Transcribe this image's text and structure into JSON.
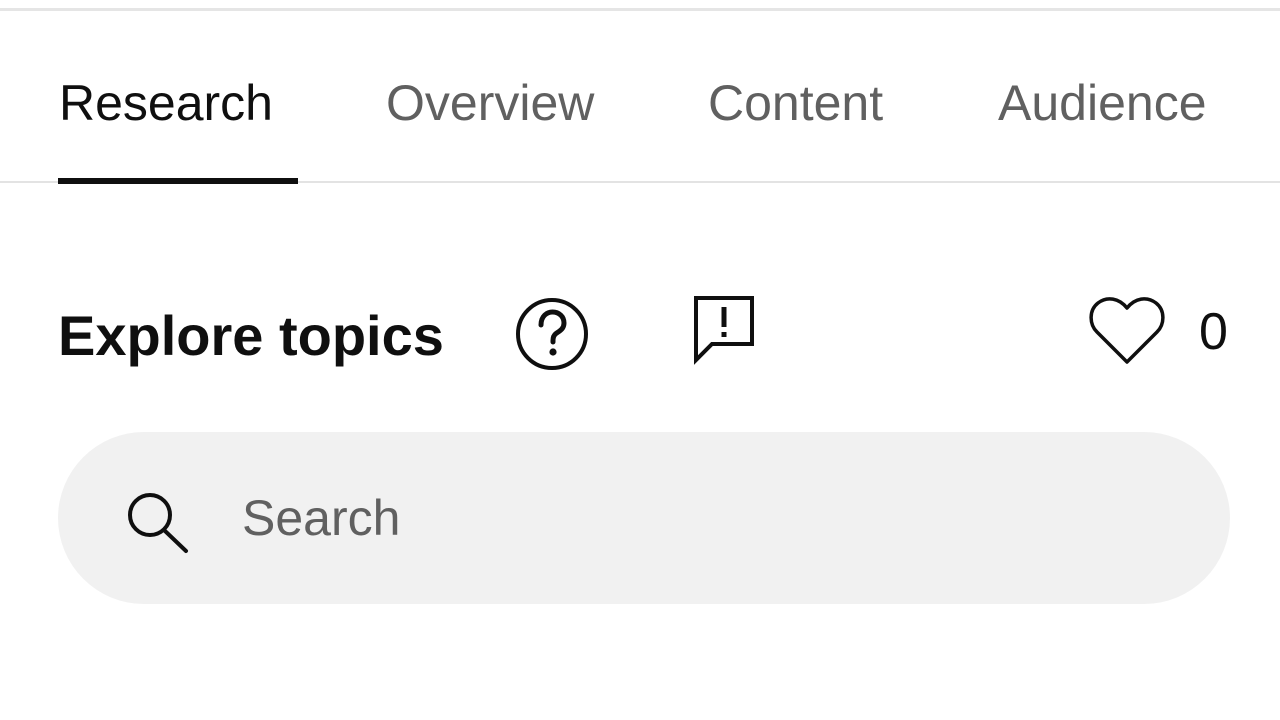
{
  "tabs": [
    {
      "label": "Research",
      "active": true
    },
    {
      "label": "Overview",
      "active": false
    },
    {
      "label": "Content",
      "active": false
    },
    {
      "label": "Audience",
      "active": false
    }
  ],
  "section": {
    "title": "Explore topics",
    "help_icon": "help-circle-icon",
    "feedback_icon": "feedback-flag-icon"
  },
  "likes": {
    "icon": "heart-outline-icon",
    "count": "0"
  },
  "search": {
    "icon": "search-icon",
    "placeholder": "Search",
    "value": ""
  },
  "colors": {
    "text_primary": "#0f0f0f",
    "text_secondary": "#606060",
    "search_background": "#f1f1f1",
    "divider": "#e3e3e3"
  }
}
